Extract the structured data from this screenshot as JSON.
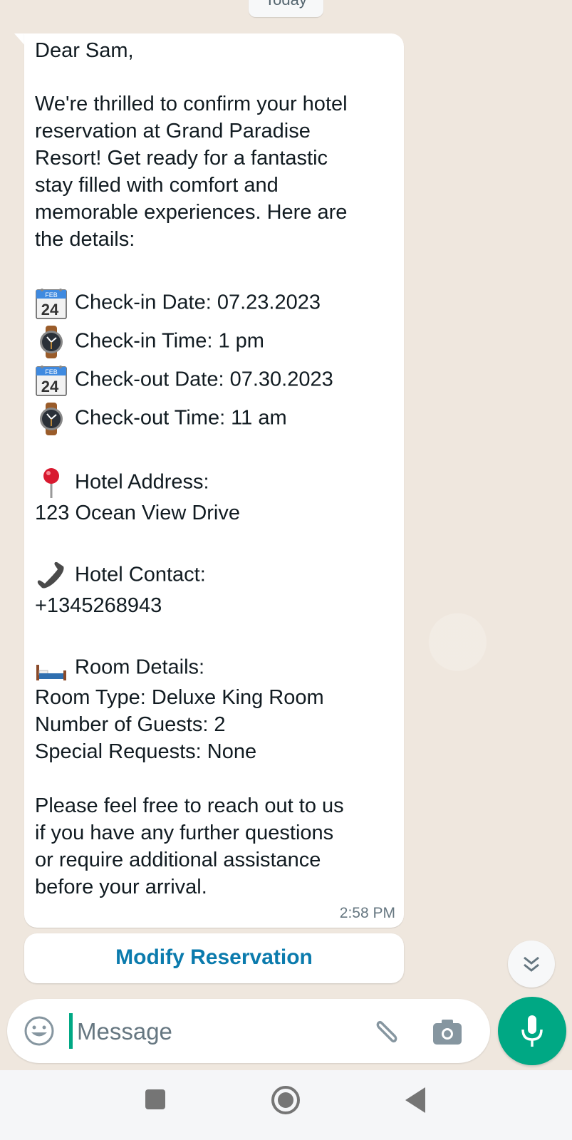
{
  "chat": {
    "date_chip": "Today",
    "message": {
      "greeting": "Dear Sam,",
      "intro_lines": [
        "We're thrilled to confirm your hotel",
        "reservation at Grand Paradise",
        "Resort! Get ready for a fantastic",
        "stay filled with comfort and",
        "memorable experiences. Here are",
        "the details:"
      ],
      "details": [
        {
          "icon": "calendar-icon",
          "text": "Check-in Date: 07.23.2023"
        },
        {
          "icon": "watch-icon",
          "text": "Check-in Time: 1 pm"
        },
        {
          "icon": "calendar-icon",
          "text": "Check-out Date: 07.30.2023"
        },
        {
          "icon": "watch-icon",
          "text": "Check-out Time: 11 am"
        }
      ],
      "address_label": "Hotel Address:",
      "address_value": "123 Ocean View Drive",
      "contact_label": "Hotel Contact:",
      "contact_value": "+1345268943",
      "room_label": "Room Details:",
      "room_lines": [
        "Room Type: Deluxe King Room",
        "Number of Guests: 2",
        "Special Requests: None"
      ],
      "closing_lines": [
        "Please feel free to reach out to us",
        "if you have any further questions",
        "or require additional assistance",
        "before your arrival."
      ],
      "timestamp": "2:58 PM",
      "calendar_month": "FEB",
      "calendar_day": "24"
    },
    "action_button": "Modify Reservation"
  },
  "composer": {
    "placeholder": "Message",
    "value": ""
  },
  "colors": {
    "accent": "#00a884",
    "link": "#0b7bad",
    "chat_background": "#efe7de"
  }
}
